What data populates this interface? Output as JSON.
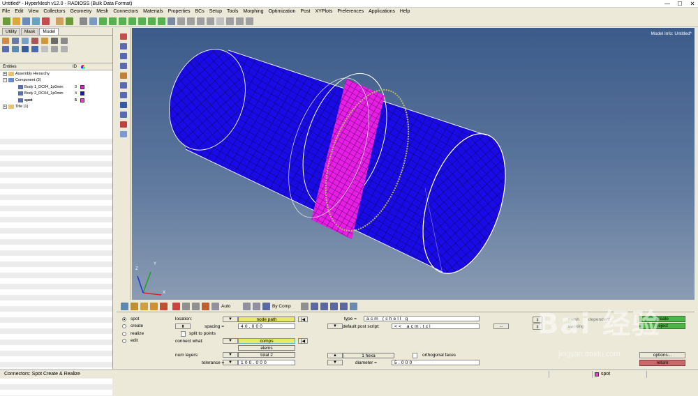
{
  "window": {
    "title": "Untitled* - HyperMesh v12.0 - RADIOSS (Bulk Data Format)",
    "min": "—",
    "max": "☐",
    "close": "✕"
  },
  "menu": [
    "File",
    "Edit",
    "View",
    "Collectors",
    "Geometry",
    "Mesh",
    "Connectors",
    "Materials",
    "Properties",
    "BCs",
    "Setup",
    "Tools",
    "Morphing",
    "Optimization",
    "Post",
    "XYPlots",
    "Preferences",
    "Applications",
    "Help"
  ],
  "left_tabs": [
    "Utility",
    "Mask",
    "Model"
  ],
  "tree": {
    "col_entities": "Entities",
    "col_id": "ID",
    "items": [
      {
        "label": "Assembly Hierarchy",
        "id": "",
        "color": ""
      },
      {
        "label": "Component (3)",
        "id": "",
        "color": ""
      },
      {
        "label": "Body 1_DC04_1p0mm",
        "id": "3",
        "color": "#e020e0"
      },
      {
        "label": "Body 2_DC04_1p0mm",
        "id": "4",
        "color": "#1414c8"
      },
      {
        "label": "spot",
        "id": "5",
        "color": "#f23ad8"
      },
      {
        "label": "Title (1)",
        "id": "",
        "color": ""
      }
    ]
  },
  "viewport": {
    "model_info": "Model Info: Untitled*",
    "axis_x": "X",
    "axis_y": "Y",
    "axis_z": "Z"
  },
  "panel_toolbar": {
    "auto": "Auto",
    "bycomp": "By Comp"
  },
  "panel": {
    "radios": [
      {
        "label": "spot",
        "selected": true
      },
      {
        "label": "create",
        "selected": false
      },
      {
        "label": "realize",
        "selected": false
      },
      {
        "label": "edit",
        "selected": false
      }
    ],
    "location_label": "location:",
    "location_value": "node path",
    "spacing_label": "spacing =",
    "spacing_value": "40.000",
    "split_label": "split to points",
    "connect_label": "connect what:",
    "connect_value": "comps",
    "elems_value": "elems",
    "num_layers_label": "num layers:",
    "num_layers_value": "total 2",
    "tolerance_label": "tolerance =",
    "tolerance_value": "100.000",
    "type_label": "type =",
    "type_value": "acm (shell g",
    "post_script_label": "default post script:",
    "post_script_value": "<<_acm.tcl",
    "hexa_value": "1 hexa",
    "ortho_label": "orthogonal faces",
    "diameter_label": "diameter =",
    "diameter_value": "5.000",
    "create_btn": "create",
    "reject_btn": "reject",
    "options_btn": "options...",
    "return_btn": "return",
    "mesh_label": "mesh",
    "dependent_label": "dependent",
    "tracking_label": "tracking"
  },
  "status": {
    "message": "Connectors: Spot Create & Realize",
    "comp": "spot"
  },
  "watermark": {
    "main": "Bai 经验",
    "sub": "jingyan.baidu.com"
  }
}
